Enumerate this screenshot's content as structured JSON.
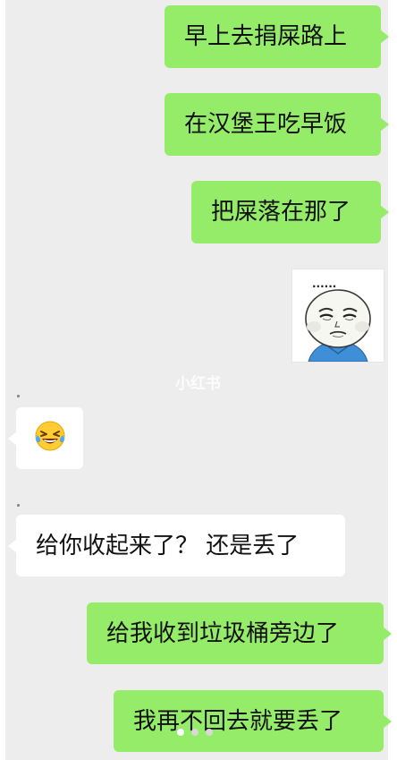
{
  "chat": {
    "messages": [
      {
        "from": "me",
        "text": "早上去捐屎路上"
      },
      {
        "from": "me",
        "text": "在汉堡王吃早饭"
      },
      {
        "from": "me",
        "text": "把屎落在那了"
      },
      {
        "from": "me",
        "type": "sticker",
        "sticker": "sad-meme-face-sticker"
      },
      {
        "from": "other",
        "type": "emoji",
        "emoji": "😂"
      },
      {
        "from": "other",
        "text": "给你收起来了？ 还是丢了"
      },
      {
        "from": "me",
        "text": "给我收到垃圾桶旁边了"
      },
      {
        "from": "me",
        "text": "我再不回去就要丢了"
      }
    ]
  },
  "sticker": {
    "ellipsis": "......"
  },
  "watermark": {
    "text": "小红书"
  },
  "pagination": {
    "count": 3,
    "active_index": 0
  },
  "colors": {
    "background": "#ededed",
    "my_bubble": "#95ec69",
    "other_bubble": "#ffffff",
    "text": "#111111"
  }
}
